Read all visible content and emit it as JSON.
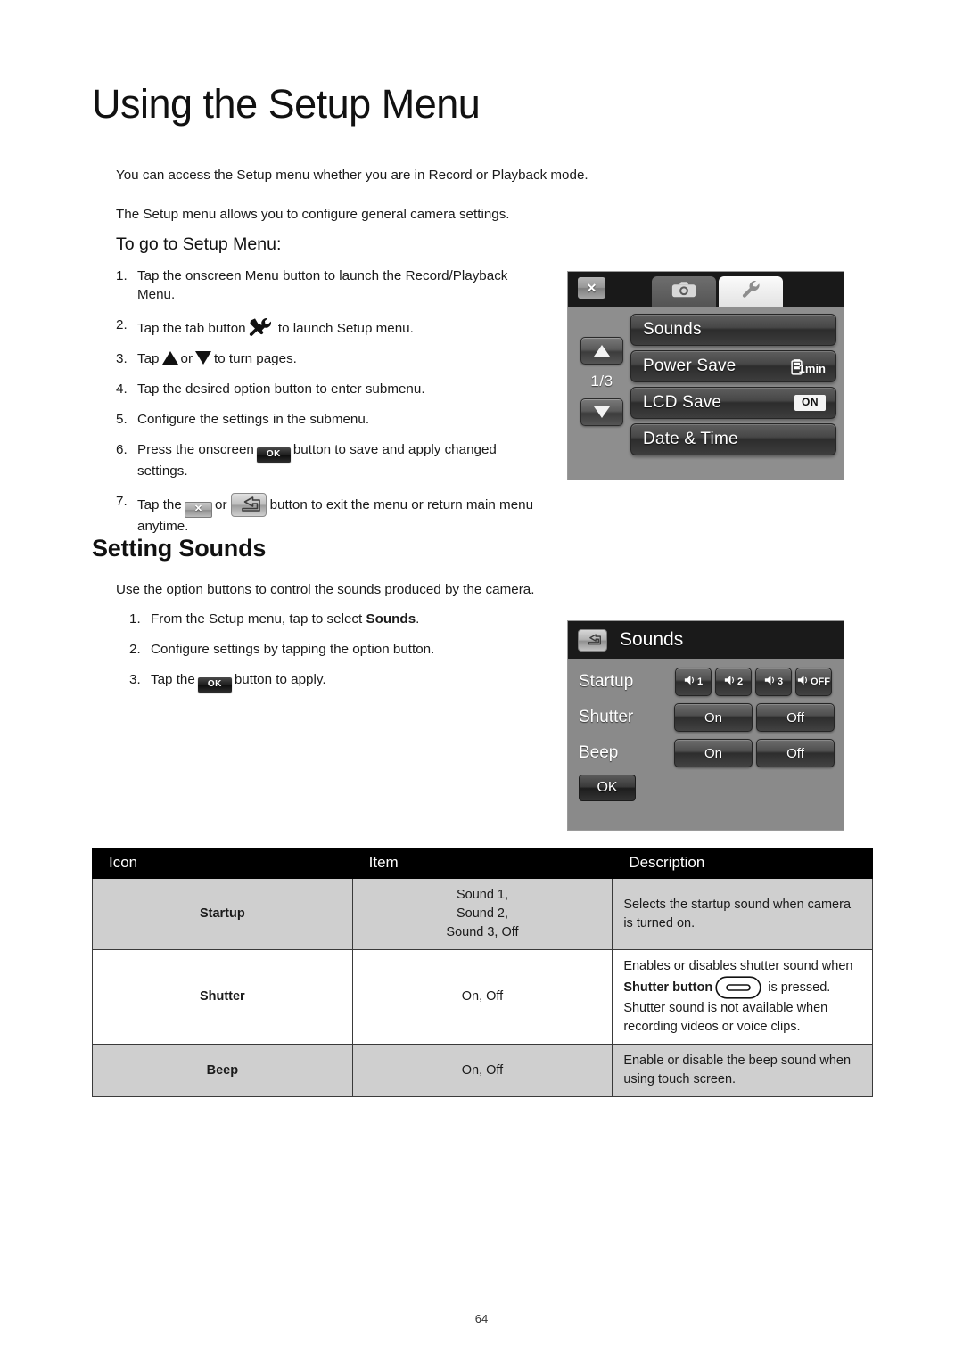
{
  "document": {
    "title": "Using the Setup Menu",
    "page_number": "64"
  },
  "intro": {
    "paragraph1": "You can access the Setup menu whether you are in Record or Playback mode.",
    "paragraph2": "The Setup menu allows you to configure general camera settings."
  },
  "setup_section": {
    "heading": "To go to Setup Menu:",
    "steps": [
      {
        "num": "1.",
        "pre": "Tap the onscreen Menu button to launch the Record/Playback Menu.",
        "post": ""
      },
      {
        "num": "2.",
        "pre": "Tap the tab button",
        "icon": "tools-icon",
        "post": "to launch Setup menu."
      },
      {
        "num": "3.",
        "pre": "Tap",
        "icon": "triangle-up-icon",
        "mid": "or",
        "icon2": "triangle-down-icon",
        "post": "to turn pages."
      },
      {
        "num": "4.",
        "pre": "Tap the desired option button to enter submenu.",
        "post": ""
      },
      {
        "num": "5.",
        "pre": "Configure the settings in the submenu.",
        "post": ""
      },
      {
        "num": "6.",
        "pre": "Press the onscreen",
        "icon": "ok-button-icon",
        "icon_label": "OK",
        "post": "button to save and apply changed settings."
      },
      {
        "num": "7.",
        "pre": "Tap the",
        "icon": "close-button-icon",
        "icon_label": "✕",
        "mid": "or",
        "icon2": "return-button-icon",
        "post": "button to exit the menu or return main menu anytime."
      }
    ]
  },
  "setup_lcd": {
    "tabbar": {
      "close_label": "✕",
      "tabs": [
        {
          "name": "record-tab",
          "icon": "camera-icon",
          "active": false
        },
        {
          "name": "setup-tab",
          "icon": "wrench-icon",
          "active": true
        }
      ]
    },
    "page_indicator": "1/3",
    "nav": {
      "up": "triangle-up-icon",
      "down": "triangle-down-icon"
    },
    "menu_items": [
      {
        "label": "Sounds",
        "value": ""
      },
      {
        "label": "Power Save",
        "value": "1min",
        "value_icon": "battery-icon"
      },
      {
        "label": "LCD Save",
        "value": "ON",
        "value_type": "badge"
      },
      {
        "label": "Date & Time",
        "value": ""
      }
    ]
  },
  "sounds_section": {
    "heading": "Setting Sounds",
    "intro": "Use the option buttons to control the sounds produced by the camera.",
    "steps": [
      {
        "num": "1.",
        "pre": "From the Setup menu, tap to select",
        "bold": "Sounds",
        "post": "."
      },
      {
        "num": "2.",
        "pre": "Configure settings by tapping the option button.",
        "post": ""
      },
      {
        "num": "3.",
        "pre": "Tap the",
        "icon": "ok-button-icon",
        "icon_label": "OK",
        "post": "button to apply."
      }
    ]
  },
  "sounds_lcd": {
    "header": {
      "back_icon": "return-icon",
      "title": "Sounds"
    },
    "rows": [
      {
        "label": "Startup",
        "type": "speaker",
        "options": [
          {
            "icon": "speaker-icon",
            "label": "1"
          },
          {
            "icon": "speaker-icon",
            "label": "2"
          },
          {
            "icon": "speaker-icon",
            "label": "3"
          },
          {
            "icon": "speaker-icon",
            "label": "OFF"
          }
        ]
      },
      {
        "label": "Shutter",
        "type": "wide",
        "options": [
          {
            "label": "On"
          },
          {
            "label": "Off"
          }
        ]
      },
      {
        "label": "Beep",
        "type": "wide",
        "options": [
          {
            "label": "On"
          },
          {
            "label": "Off"
          }
        ]
      }
    ],
    "ok_label": "OK"
  },
  "table": {
    "headers": [
      "Icon",
      "Item",
      "Description"
    ],
    "rows": [
      {
        "icon": "Startup",
        "item": "Sound 1,\nSound 2,\nSound 3, Off",
        "desc_pre": "Selects the startup sound when camera is turned on.",
        "shade": true
      },
      {
        "icon": "Shutter",
        "item": "On, Off",
        "desc_pre": "Enables or disables shutter sound when ",
        "desc_bold": "Shutter button",
        "desc_icon": "shutter-button-icon",
        "desc_post": " is pressed. Shutter sound is not available when recording videos or voice clips.",
        "shade": false
      },
      {
        "icon": "Beep",
        "item": "On, Off",
        "desc_pre": "Enable or disable the beep sound when using touch screen.",
        "shade": true
      }
    ]
  },
  "colors": {
    "header_bg": "#000000",
    "row_shade": "#cfcfcf",
    "lcd_bezel": "#8e8e8e",
    "lcd_dark": "#1a1a1a"
  }
}
